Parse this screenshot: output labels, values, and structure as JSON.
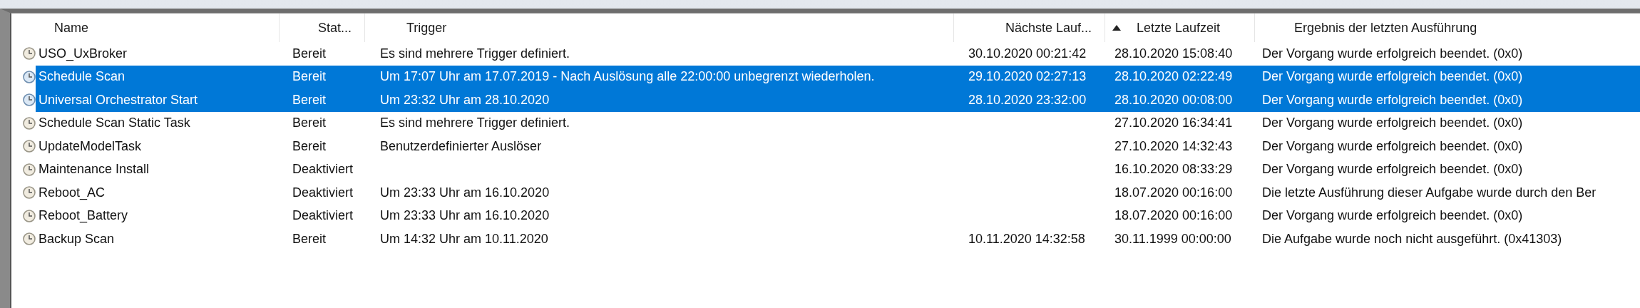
{
  "columns": [
    {
      "label": "Name",
      "sorted": false
    },
    {
      "label": "Stat...",
      "sorted": false
    },
    {
      "label": "Trigger",
      "sorted": false
    },
    {
      "label": "Nächste Lauf...",
      "sorted": false
    },
    {
      "label": "Letzte Laufzeit",
      "sorted": true
    },
    {
      "label": "Ergebnis der letzten Ausführung",
      "sorted": false
    }
  ],
  "rows": [
    {
      "name": "USO_UxBroker",
      "status": "Bereit",
      "trigger": "Es sind mehrere Trigger definiert.",
      "next_run": "30.10.2020 00:21:42",
      "last_run": "28.10.2020 15:08:40",
      "last_result": "Der Vorgang wurde erfolgreich beendet. (0x0)",
      "selected": false
    },
    {
      "name": "Schedule Scan",
      "status": "Bereit",
      "trigger": "Um 17:07 Uhr am 17.07.2019 - Nach Auslösung alle 22:00:00 unbegrenzt wiederholen.",
      "next_run": "29.10.2020 02:27:13",
      "last_run": "28.10.2020 02:22:49",
      "last_result": "Der Vorgang wurde erfolgreich beendet. (0x0)",
      "selected": true
    },
    {
      "name": "Universal Orchestrator Start",
      "status": "Bereit",
      "trigger": "Um 23:32 Uhr am 28.10.2020",
      "next_run": "28.10.2020 23:32:00",
      "last_run": "28.10.2020 00:08:00",
      "last_result": "Der Vorgang wurde erfolgreich beendet. (0x0)",
      "selected": true
    },
    {
      "name": "Schedule Scan Static Task",
      "status": "Bereit",
      "trigger": "Es sind mehrere Trigger definiert.",
      "last_run": "27.10.2020 16:34:41",
      "last_result": "Der Vorgang wurde erfolgreich beendet. (0x0)",
      "selected": false
    },
    {
      "name": "UpdateModelTask",
      "status": "Bereit",
      "trigger": "Benutzerdefinierter Auslöser",
      "last_run": "27.10.2020 14:32:43",
      "last_result": "Der Vorgang wurde erfolgreich beendet. (0x0)",
      "selected": false
    },
    {
      "name": "Maintenance Install",
      "status": "Deaktiviert",
      "last_run": "16.10.2020 08:33:29",
      "last_result": "Der Vorgang wurde erfolgreich beendet. (0x0)",
      "selected": false
    },
    {
      "name": "Reboot_AC",
      "status": "Deaktiviert",
      "trigger": "Um 23:33 Uhr am 16.10.2020",
      "last_run": "18.07.2020 00:16:00",
      "last_result": "Die letzte Ausführung dieser Aufgabe wurde durch den Ber",
      "selected": false
    },
    {
      "name": "Reboot_Battery",
      "status": "Deaktiviert",
      "trigger": "Um 23:33 Uhr am 16.10.2020",
      "last_run": "18.07.2020 00:16:00",
      "last_result": "Der Vorgang wurde erfolgreich beendet. (0x0)",
      "selected": false
    },
    {
      "name": "Backup Scan",
      "status": "Bereit",
      "trigger": "Um 14:32 Uhr am 10.11.2020",
      "next_run": "10.11.2020 14:32:58",
      "last_run": "30.11.1999 00:00:00",
      "last_result": "Die Aufgabe wurde noch nicht ausgeführt. (0x41303)",
      "selected": false
    }
  ]
}
